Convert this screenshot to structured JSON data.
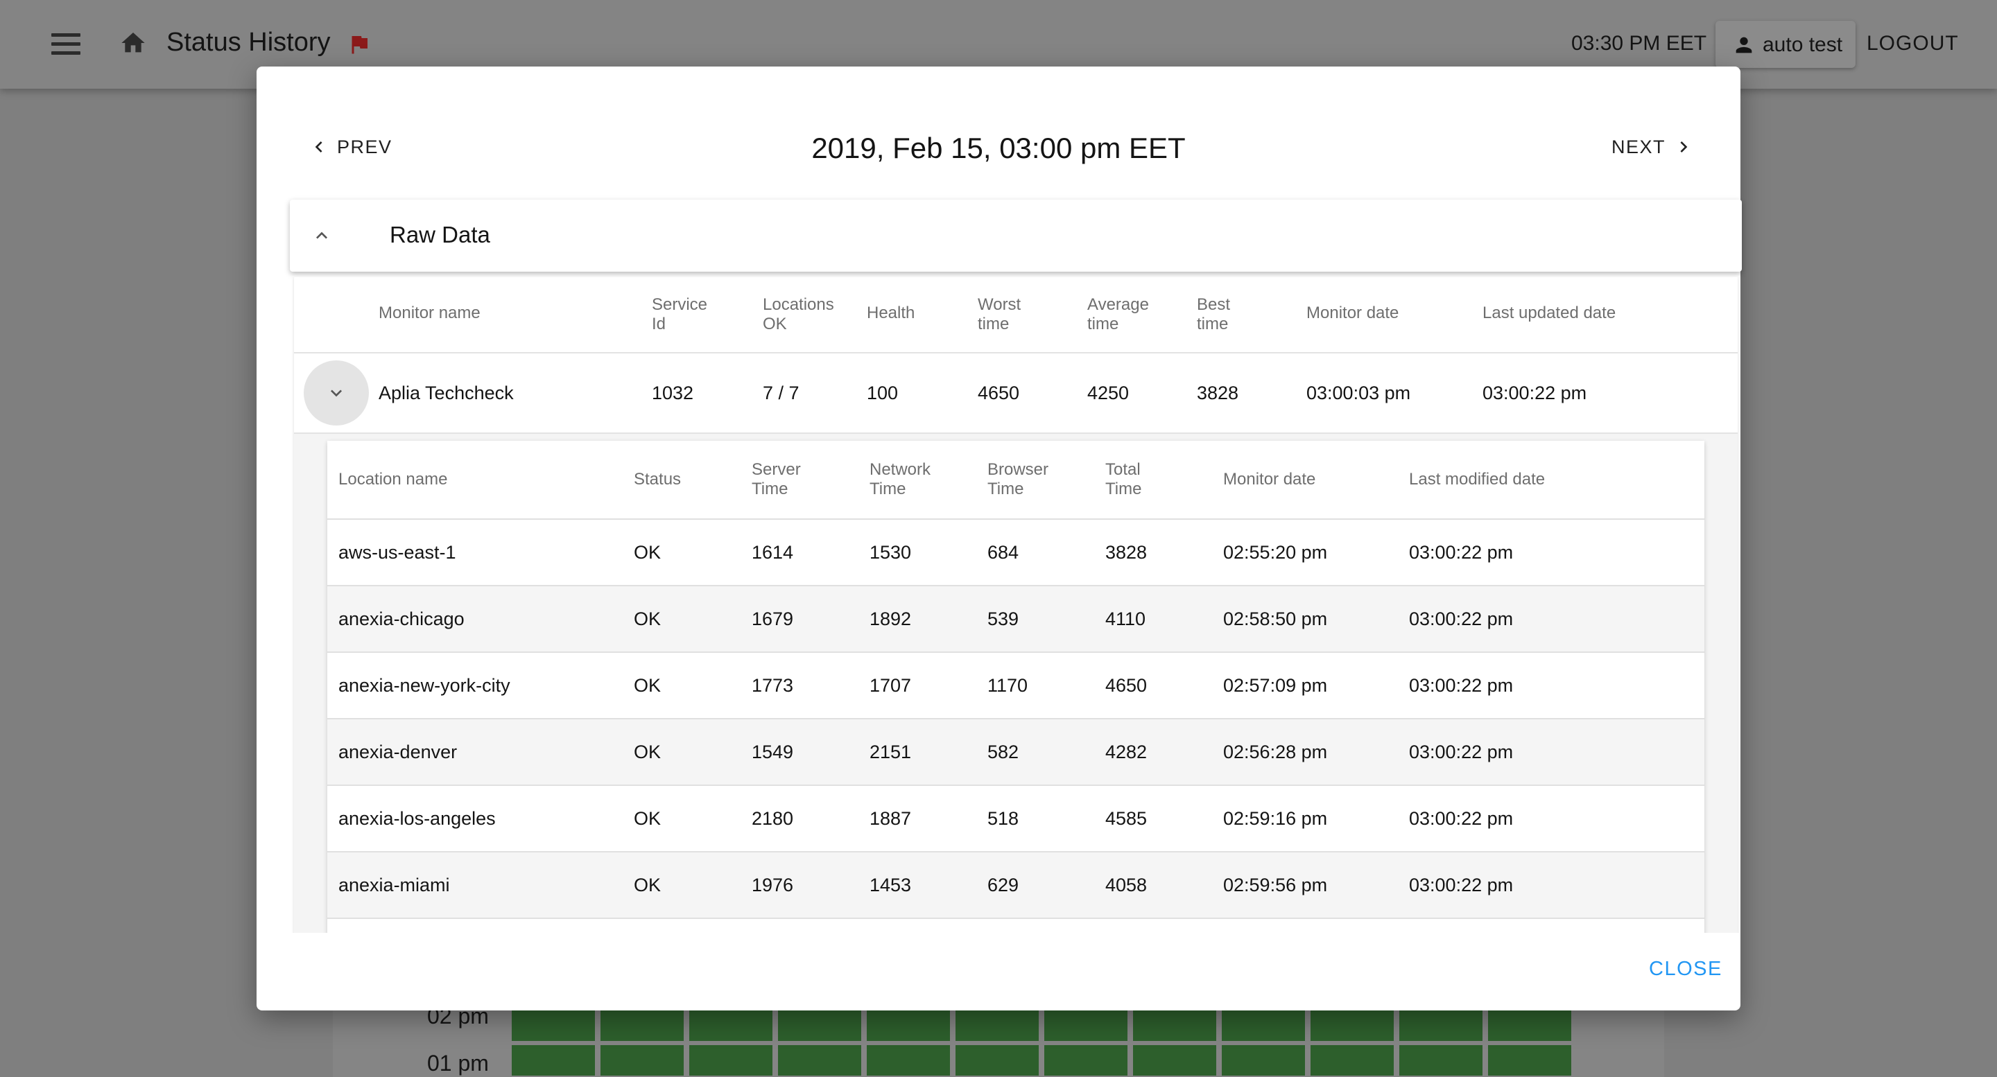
{
  "appbar": {
    "title": "Status History",
    "time": "03:30 PM EET",
    "user": "auto test",
    "logout": "LOGOUT"
  },
  "background": {
    "rows": [
      {
        "label": "02 pm"
      },
      {
        "label": "01 pm"
      }
    ]
  },
  "dialog": {
    "prev_label": "PREV",
    "next_label": "NEXT",
    "date": "2019, Feb 15, 03:00 pm EET",
    "raw_data_label": "Raw Data",
    "close_label": "CLOSE",
    "monitor_table": {
      "headers": {
        "name": "Monitor name",
        "service_id": [
          "Service",
          "Id"
        ],
        "locations_ok": [
          "Locations",
          "OK"
        ],
        "health": "Health",
        "worst": [
          "Worst",
          "time"
        ],
        "average": [
          "Average",
          "time"
        ],
        "best": [
          "Best",
          "time"
        ],
        "monitor_date": "Monitor date",
        "last_updated": "Last updated date"
      },
      "row": {
        "name": "Aplia Techcheck",
        "service_id": "1032",
        "locations_ok": "7 / 7",
        "health": "100",
        "worst": "4650",
        "average": "4250",
        "best": "3828",
        "monitor_date": "03:00:03 pm",
        "last_updated": "03:00:22 pm"
      }
    },
    "location_table": {
      "headers": {
        "location": "Location name",
        "status": "Status",
        "server": [
          "Server",
          "Time"
        ],
        "network": [
          "Network",
          "Time"
        ],
        "browser": [
          "Browser",
          "Time"
        ],
        "total": [
          "Total",
          "Time"
        ],
        "monitor_date": "Monitor date",
        "last_modified": "Last modified date"
      },
      "rows": [
        {
          "location": "aws-us-east-1",
          "status": "OK",
          "server": "1614",
          "network": "1530",
          "browser": "684",
          "total": "3828",
          "monitor_date": "02:55:20 pm",
          "last_modified": "03:00:22 pm"
        },
        {
          "location": "anexia-chicago",
          "status": "OK",
          "server": "1679",
          "network": "1892",
          "browser": "539",
          "total": "4110",
          "monitor_date": "02:58:50 pm",
          "last_modified": "03:00:22 pm"
        },
        {
          "location": "anexia-new-york-city",
          "status": "OK",
          "server": "1773",
          "network": "1707",
          "browser": "1170",
          "total": "4650",
          "monitor_date": "02:57:09 pm",
          "last_modified": "03:00:22 pm"
        },
        {
          "location": "anexia-denver",
          "status": "OK",
          "server": "1549",
          "network": "2151",
          "browser": "582",
          "total": "4282",
          "monitor_date": "02:56:28 pm",
          "last_modified": "03:00:22 pm"
        },
        {
          "location": "anexia-los-angeles",
          "status": "OK",
          "server": "2180",
          "network": "1887",
          "browser": "518",
          "total": "4585",
          "monitor_date": "02:59:16 pm",
          "last_modified": "03:00:22 pm"
        },
        {
          "location": "anexia-miami",
          "status": "OK",
          "server": "1976",
          "network": "1453",
          "browser": "629",
          "total": "4058",
          "monitor_date": "02:59:56 pm",
          "last_modified": "03:00:22 pm"
        }
      ]
    }
  }
}
